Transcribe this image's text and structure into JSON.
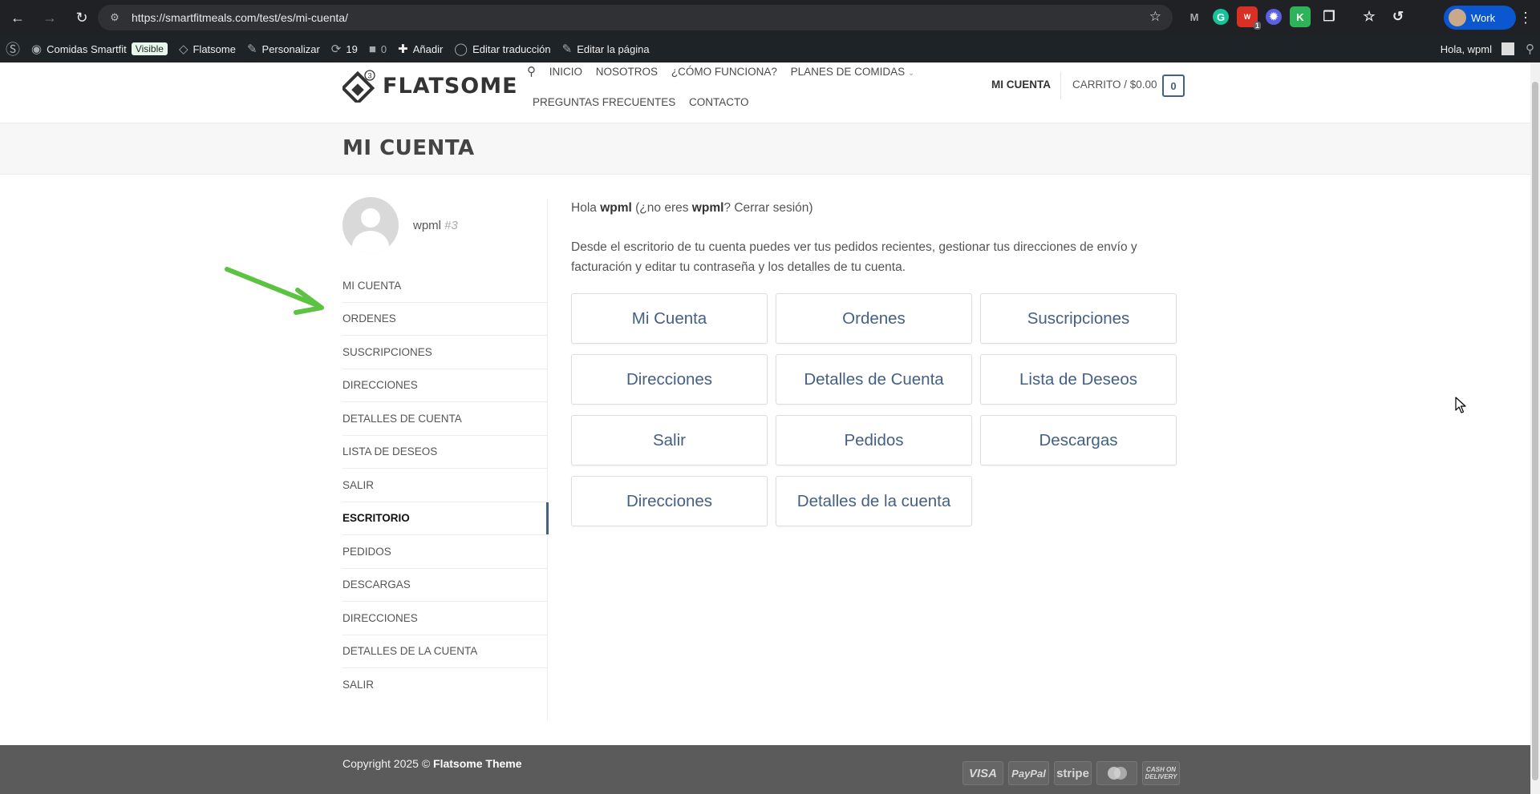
{
  "browser": {
    "url": "https://smartfitmeals.com/test/es/mi-cuenta/",
    "profile_label": "Work",
    "extensions": [
      "metamask-icon",
      "grammarly-icon",
      "badge-extension-icon",
      "wpml-extension-icon",
      "keeper-icon",
      "puzzle-icon"
    ],
    "extension_badge": "1"
  },
  "adminbar": {
    "site_name": "Comidas Smartfit",
    "visible_badge": "Visible",
    "theme": "Flatsome",
    "customize": "Personalizar",
    "updates_count": "19",
    "comments_count": "0",
    "add_new": "Añadir",
    "edit_translation": "Editar traducción",
    "edit_page": "Editar la página",
    "greeting": "Hola, wpml"
  },
  "header": {
    "logo_text": "FLATSOME",
    "logo_badge": "3",
    "menu_row1": [
      "INICIO",
      "NOSOTROS",
      "¿CÓMO FUNCIONA?",
      "PLANES DE COMIDAS"
    ],
    "menu_row2": [
      "PREGUNTAS FRECUENTES",
      "CONTACTO"
    ],
    "account": "MI CUENTA",
    "cart_label": "CARRITO / $0.00",
    "cart_count": "0"
  },
  "page": {
    "title": "MI CUENTA"
  },
  "profile": {
    "username": "wpml",
    "user_id": "#3"
  },
  "sidebar": {
    "items": [
      {
        "label": "MI CUENTA"
      },
      {
        "label": "ORDENES"
      },
      {
        "label": "SUSCRIPCIONES"
      },
      {
        "label": "DIRECCIONES"
      },
      {
        "label": "DETALLES DE CUENTA"
      },
      {
        "label": "LISTA DE DESEOS"
      },
      {
        "label": "SALIR"
      },
      {
        "label": "ESCRITORIO",
        "active": true
      },
      {
        "label": "PEDIDOS"
      },
      {
        "label": "DESCARGAS"
      },
      {
        "label": "DIRECCIONES"
      },
      {
        "label": "DETALLES DE LA CUENTA"
      },
      {
        "label": "SALIR"
      }
    ]
  },
  "main": {
    "greeting": {
      "hello": "Hola",
      "user": "wpml",
      "not_you": "(¿no eres",
      "user2": "wpml",
      "logout": "? Cerrar sesión)"
    },
    "intro": "Desde el escritorio de tu cuenta puedes ver tus pedidos recientes, gestionar tus direcciones de envío y facturación y editar tu contraseña y los detalles de tu cuenta.",
    "tiles": [
      "Mi Cuenta",
      "Ordenes",
      "Suscripciones",
      "Direcciones",
      "Detalles de Cuenta",
      "Lista de Deseos",
      "Salir",
      "Pedidos",
      "Descargas",
      "Direcciones",
      "Detalles de la cuenta"
    ]
  },
  "footer": {
    "copyright_prefix": "Copyright 2025 ©",
    "copyright_theme": "Flatsome Theme",
    "payments": [
      "VISA",
      "PayPal",
      "stripe",
      "",
      "CASH ON DELIVERY"
    ]
  },
  "colors": {
    "accent": "#446084",
    "arrow": "#5cc342",
    "footer_bg": "#5b5b5b"
  }
}
